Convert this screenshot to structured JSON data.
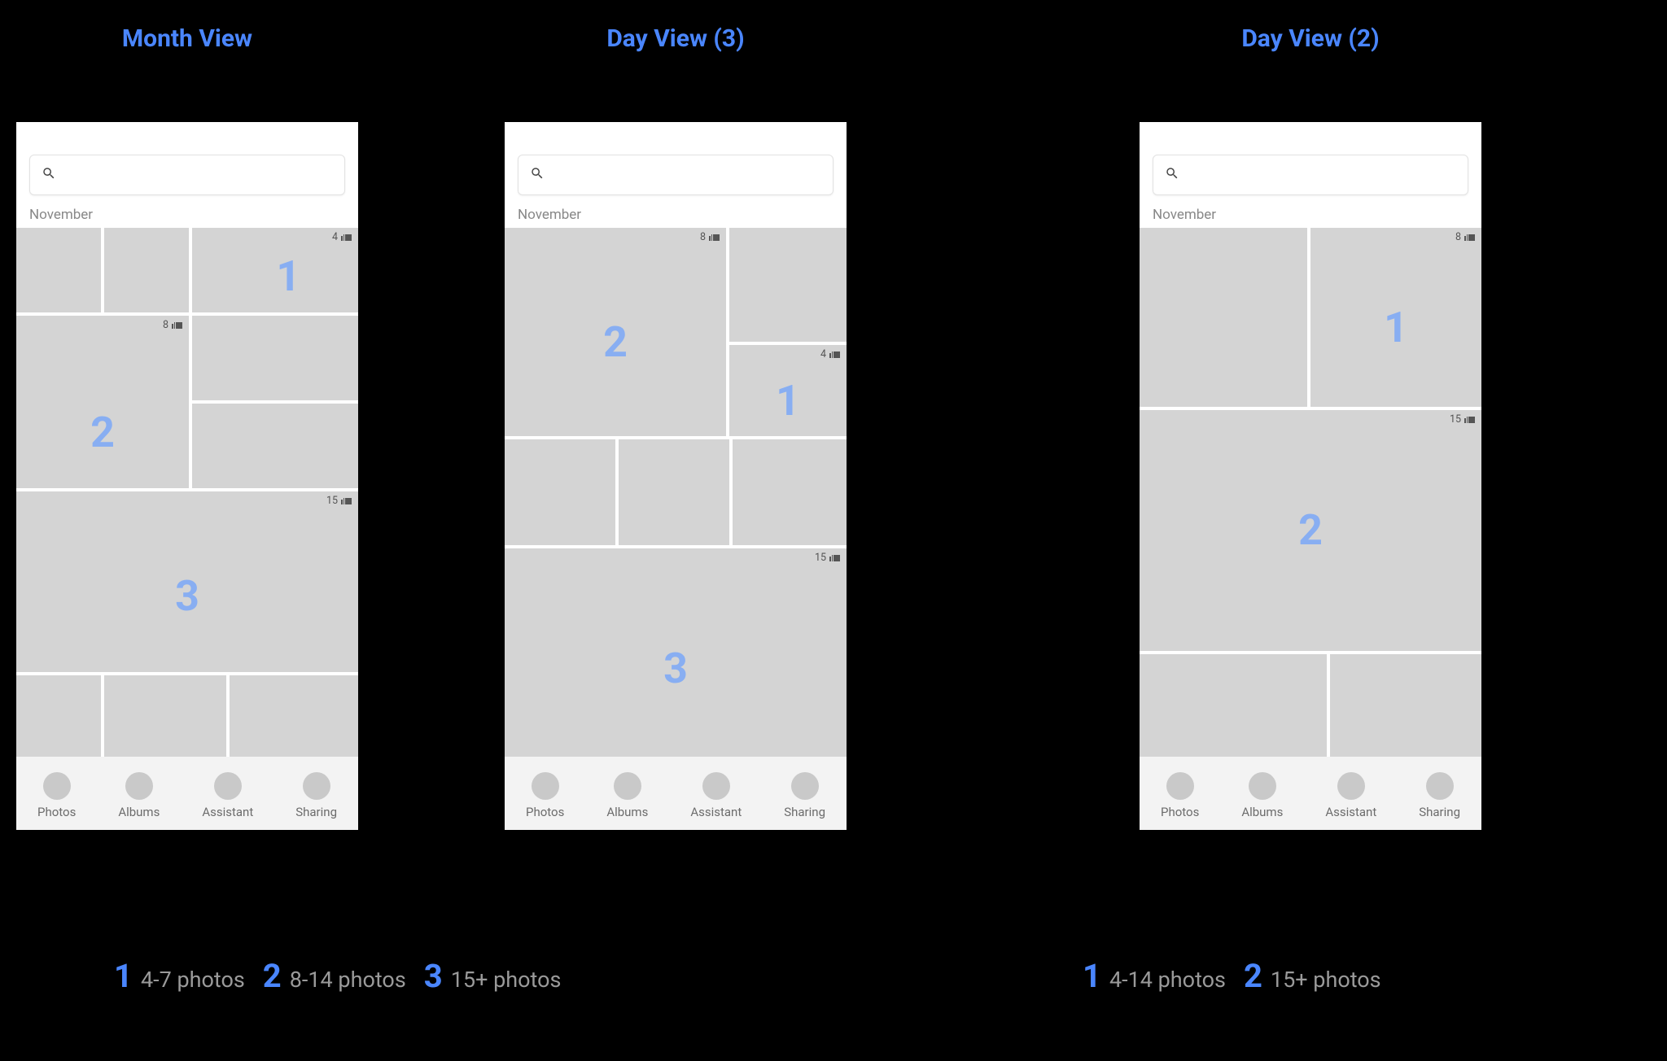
{
  "accent_blue": "#4a86ff",
  "tile_grey": "#d4d4d4",
  "columns": [
    {
      "title": "Month View"
    },
    {
      "title": "Day View (3)"
    },
    {
      "title": "Day View (2)"
    }
  ],
  "month_label": "November",
  "nav": [
    {
      "label": "Photos"
    },
    {
      "label": "Albums"
    },
    {
      "label": "Assistant"
    },
    {
      "label": "Sharing"
    }
  ],
  "badges": {
    "tier1_count": "4",
    "tier2_count": "8",
    "tier3_count": "15"
  },
  "tier_labels": {
    "t1": "1",
    "t2": "2",
    "t3": "3"
  },
  "legend_left": [
    {
      "num": "1",
      "text": "4-7 photos"
    },
    {
      "num": "2",
      "text": "8-14 photos"
    },
    {
      "num": "3",
      "text": "15+ photos"
    }
  ],
  "legend_right": [
    {
      "num": "1",
      "text": "4-14 photos"
    },
    {
      "num": "2",
      "text": "15+ photos"
    }
  ]
}
